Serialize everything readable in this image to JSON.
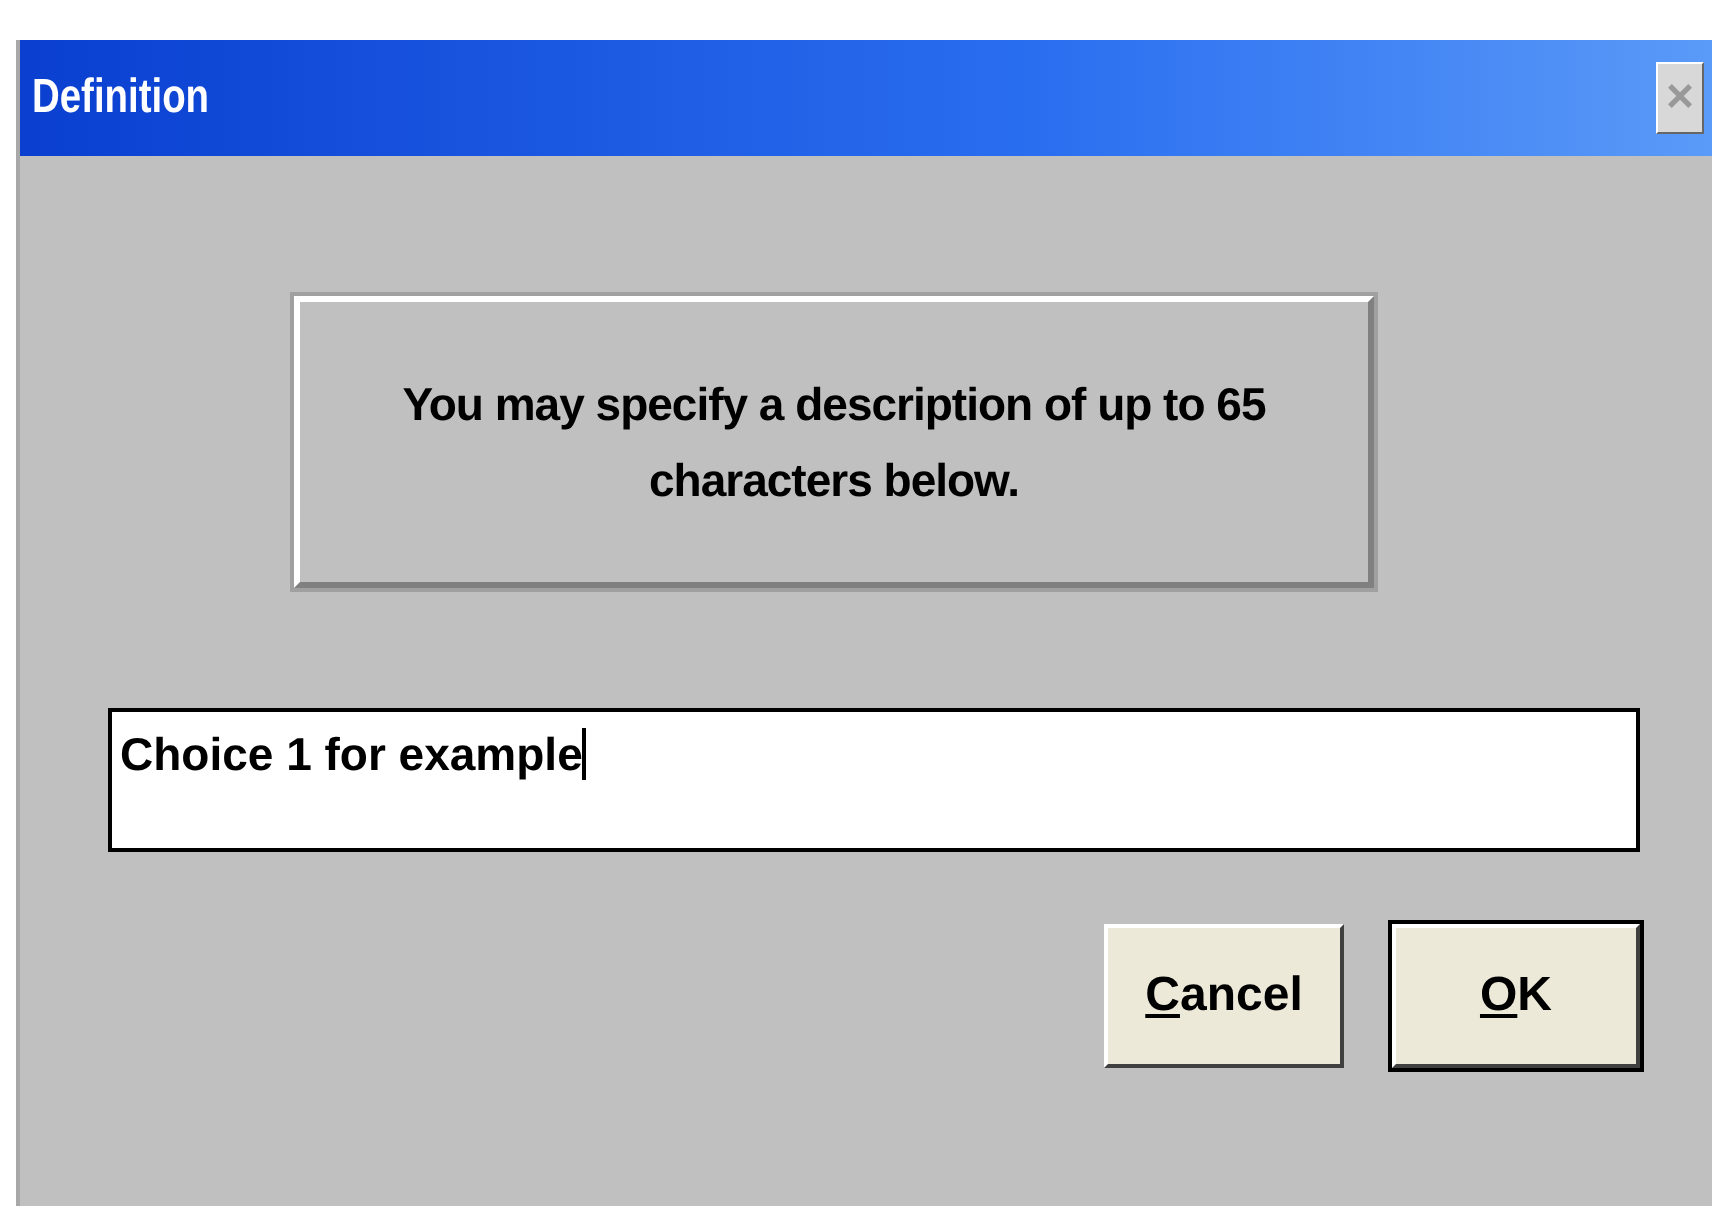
{
  "window": {
    "title": "Definition",
    "close_disabled": true,
    "close_glyph": "×"
  },
  "message": "You may specify a description of up to 65 characters below.",
  "description_field": {
    "value": "Choice 1 for example",
    "focused": true
  },
  "buttons": [
    {
      "label": "Cancel",
      "first_letter_underlined": true,
      "default": false
    },
    {
      "label": "OK",
      "first_letter_underlined": true,
      "default": true
    }
  ]
}
